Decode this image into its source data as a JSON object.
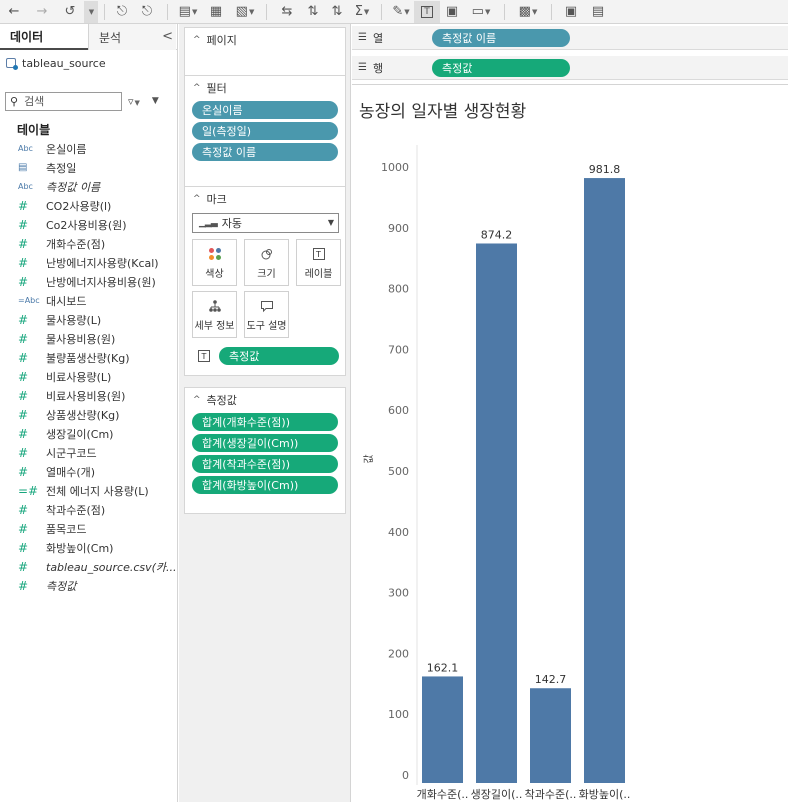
{
  "left_pane": {
    "tabs": [
      "데이터",
      "분석"
    ],
    "collapse": "<",
    "source": "tableau_source",
    "search_placeholder": "검색",
    "tables_heading": "테이블",
    "fields": [
      {
        "type": "abc",
        "name": "온실이름",
        "italic": false
      },
      {
        "type": "cal",
        "name": "측정일",
        "italic": false
      },
      {
        "type": "abc",
        "name": "측정값 이름",
        "italic": true
      },
      {
        "type": "num",
        "name": "CO2사용량(l)",
        "italic": false
      },
      {
        "type": "num",
        "name": "Co2사용비용(원)",
        "italic": false
      },
      {
        "type": "num",
        "name": "개화수준(점)",
        "italic": false
      },
      {
        "type": "num",
        "name": "난방에너지사용량(Kcal)",
        "italic": false
      },
      {
        "type": "num",
        "name": "난방에너지사용비용(원)",
        "italic": false
      },
      {
        "type": "abc2",
        "name": "대시보드",
        "italic": false
      },
      {
        "type": "num",
        "name": "물사용량(L)",
        "italic": false
      },
      {
        "type": "num",
        "name": "물사용비용(원)",
        "italic": false
      },
      {
        "type": "num",
        "name": "불량품생산량(Kg)",
        "italic": false
      },
      {
        "type": "num",
        "name": "비료사용량(L)",
        "italic": false
      },
      {
        "type": "num",
        "name": "비료사용비용(원)",
        "italic": false
      },
      {
        "type": "num",
        "name": "상품생산량(Kg)",
        "italic": false
      },
      {
        "type": "num",
        "name": "생장길이(Cm)",
        "italic": false
      },
      {
        "type": "num",
        "name": "시군구코드",
        "italic": false
      },
      {
        "type": "num",
        "name": "열매수(개)",
        "italic": false
      },
      {
        "type": "num2",
        "name": "전체 에너지 사용량(L)",
        "italic": false
      },
      {
        "type": "num",
        "name": "착과수준(점)",
        "italic": false
      },
      {
        "type": "num",
        "name": "품목코드",
        "italic": false
      },
      {
        "type": "num",
        "name": "화방높이(Cm)",
        "italic": false
      },
      {
        "type": "num",
        "name": "tableau_source.csv(카...",
        "italic": true
      },
      {
        "type": "num",
        "name": "측정값",
        "italic": true
      }
    ]
  },
  "cards": {
    "pages": "페이지",
    "filters": {
      "title": "필터",
      "pills": [
        "온실이름",
        "일(측정일)",
        "측정값 이름"
      ]
    },
    "marks": {
      "title": "마크",
      "mark_type": "자동",
      "buttons": [
        "색상",
        "크기",
        "레이블",
        "세부 정보",
        "도구 설명"
      ],
      "label_pill": "측정값"
    },
    "measure_values": {
      "title": "측정값",
      "pills": [
        "합계(개화수준(점))",
        "합계(생장길이(Cm))",
        "합계(착과수준(점))",
        "합계(화방높이(Cm))"
      ]
    }
  },
  "shelves": {
    "columns": {
      "label": "열",
      "pill": "측정값 이름"
    },
    "rows": {
      "label": "행",
      "pill": "측정값"
    }
  },
  "chart_data": {
    "type": "bar",
    "title": "농장의 일자별 생장현황",
    "categories": [
      "개화수준(..",
      "생장길이(..",
      "착과수준(..",
      "화방높이(.."
    ],
    "values": [
      162.1,
      874.2,
      142.7,
      981.8
    ],
    "value_labels": [
      "162.1",
      "874.2",
      "142.7",
      "981.8"
    ],
    "ylabel": "값",
    "ylim": [
      0,
      1000
    ],
    "yticks": [
      0,
      100,
      200,
      300,
      400,
      500,
      600,
      700,
      800,
      900,
      1000
    ],
    "bar_color": "#4e79a7",
    "grid": false
  },
  "colors": {
    "blue_pill": "#4a98ad",
    "green_pill": "#16a979",
    "bar": "#4e79a7"
  }
}
